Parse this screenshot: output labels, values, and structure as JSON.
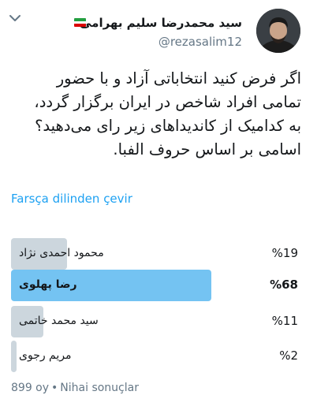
{
  "author": {
    "display_name": "سید محمدرضا سلیم بهرامی",
    "handle": "@rezasalim12",
    "flag_colors": [
      "#239f40",
      "#ffffff",
      "#da0000"
    ]
  },
  "tweet": {
    "lines": [
      "اگر فرض کنید انتخاباتی آزاد و با حضور",
      "تمامی افراد شاخص در ایران برگزار گردد،",
      "به کدامیک از کاندیداهای زیر رای می‌دهید؟",
      "اسامی بر اساس حروف الفبا."
    ],
    "translate_label": "Farsça dilinden çevir"
  },
  "poll": {
    "options": [
      {
        "label": "محمود احمدی نژاد",
        "percent_text": "%19",
        "fraction": 0.19,
        "winner": false
      },
      {
        "label": "رضا پهلوی",
        "percent_text": "%68",
        "fraction": 0.68,
        "winner": true
      },
      {
        "label": "سید محمد خاتمی",
        "percent_text": "%11",
        "fraction": 0.11,
        "winner": false
      },
      {
        "label": "مریم رجوی",
        "percent_text": "%2",
        "fraction": 0.02,
        "winner": false
      }
    ],
    "votes_text": "899 oy",
    "status_text": "Nihai sonuçlar"
  },
  "colors": {
    "accent": "#1da1f2",
    "bar_winner": "#74c3f2",
    "bar_default": "#ccd6dd"
  }
}
